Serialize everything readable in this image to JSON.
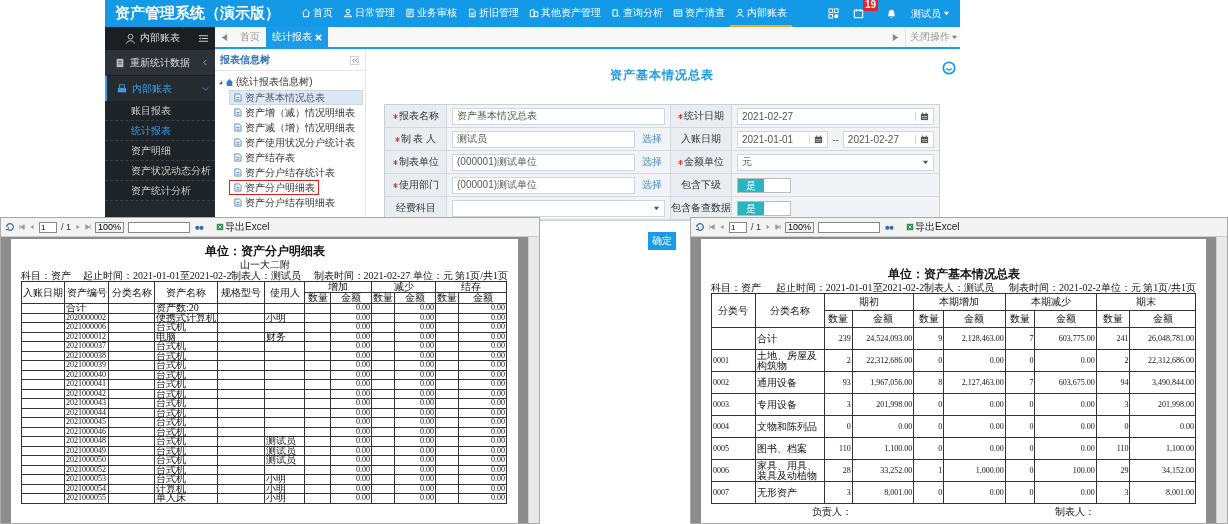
{
  "header": {
    "title": "资产管理系统（演示版）",
    "nav": [
      {
        "label": "首页",
        "selected": false
      },
      {
        "label": "日常管理",
        "selected": false
      },
      {
        "label": "业务审核",
        "selected": false
      },
      {
        "label": "折旧管理",
        "selected": false
      },
      {
        "label": "其他资产管理",
        "selected": false
      },
      {
        "label": "查询分析",
        "selected": false
      },
      {
        "label": "资产清查",
        "selected": false
      },
      {
        "label": "内部账表",
        "selected": true
      }
    ],
    "badge": "19",
    "user": "测试员"
  },
  "sidebar": {
    "title": "内部账表",
    "items": [
      {
        "label": "重新统计数据",
        "expanded": false
      },
      {
        "label": "内部账表",
        "expanded": true,
        "children": [
          {
            "label": "账目报表",
            "selected": false
          },
          {
            "label": "统计报表",
            "selected": true
          },
          {
            "label": "资产明细",
            "selected": false
          },
          {
            "label": "资产状况动态分析",
            "selected": false
          },
          {
            "label": "资产统计分析",
            "selected": false
          }
        ]
      }
    ]
  },
  "tabs": [
    {
      "label": "首页",
      "selected": false,
      "closable": false
    },
    {
      "label": "统计报表",
      "selected": true,
      "closable": true
    }
  ],
  "tab_menu": "关闭操作",
  "tree": {
    "title": "报表信息树",
    "root": {
      "label": "(统计报表信息树)",
      "expanded": true,
      "children": [
        {
          "label": "资产基本情况总表",
          "selected": true,
          "marked": false
        },
        {
          "label": "资产增（减）情况明细表",
          "selected": false,
          "marked": false
        },
        {
          "label": "资产减（增）情况明细表",
          "selected": false,
          "marked": false
        },
        {
          "label": "资产使用状况分户统计表",
          "selected": false,
          "marked": false
        },
        {
          "label": "资产结存表",
          "selected": false,
          "marked": false
        },
        {
          "label": "资产分户结存统计表",
          "selected": false,
          "marked": false
        },
        {
          "label": "资产分户明细表",
          "selected": false,
          "marked": true
        },
        {
          "label": "资产分户结存明细表",
          "selected": false,
          "marked": false
        }
      ]
    }
  },
  "form": {
    "title": "资产基本情况总表",
    "fields": [
      {
        "kind": "text",
        "label": "报表名称",
        "required": true,
        "value": "资产基本情况总表"
      },
      {
        "kind": "date",
        "label": "统计日期",
        "required": true,
        "value": "2021-02-27"
      },
      {
        "kind": "text",
        "label": "制 表 人",
        "required": true,
        "value": "测试员",
        "action": "选择"
      },
      {
        "kind": "date_range",
        "label": "入账日期",
        "required": false,
        "from": "2021-01-01",
        "separator": "--",
        "to": "2021-02-27"
      },
      {
        "kind": "text",
        "label": "制表单位",
        "required": true,
        "value": "(000001)测试单位",
        "action": "选择"
      },
      {
        "kind": "select",
        "label": "金额单位",
        "required": true,
        "value": "元"
      },
      {
        "kind": "text",
        "label": "使用部门",
        "required": true,
        "value": "(000001)测试单位",
        "action": "选择"
      },
      {
        "kind": "toggle",
        "label": "包含下级",
        "required": false,
        "on": true,
        "text": "是"
      },
      {
        "kind": "select",
        "label": "经费科目",
        "required": false
      },
      {
        "kind": "toggle",
        "label": "包含备查数据",
        "required": false,
        "on": true,
        "text": "是"
      }
    ],
    "submit": "确定"
  },
  "detail_report": {
    "toolbar": {
      "page": "1",
      "pages": "/ 1",
      "zoom": "100%",
      "export": "导出Excel"
    },
    "title": "单位：资产分户明细表",
    "subtitle": "山一大二附",
    "meta": [
      "科目：资产",
      "起止时间：2021-01-01至2021-02-2制表人：测试员",
      "制表时间：2021-02-27  单位：元  第1页/共1页"
    ],
    "columns": [
      "入账日期",
      "资产编号",
      "分类名称",
      "资产名称",
      "规格型号",
      "使用人"
    ],
    "groups": [
      {
        "label": "增加",
        "sub": [
          "数量",
          "金额"
        ]
      },
      {
        "label": "减少",
        "sub": [
          "数量",
          "金额"
        ]
      },
      {
        "label": "结存",
        "sub": [
          "数量",
          "金额"
        ]
      }
    ],
    "rows": [
      {
        "kind": "total",
        "code": "合计",
        "name": "资产数:20",
        "amounts": [
          "0.00",
          "0.00",
          "0.00"
        ]
      },
      {
        "kind": "item",
        "code": "2020000002",
        "name": "便携式计算机",
        "user": "小明",
        "amounts": [
          "0.00",
          "0.00",
          "0.00"
        ]
      },
      {
        "code": "2021000006",
        "name": "台式机",
        "amounts": [
          "0.00",
          "0.00",
          "0.00"
        ]
      },
      {
        "code": "2021000012",
        "name": "电脑",
        "user": "财务",
        "amounts": [
          "0.00",
          "0.00",
          "0.00"
        ]
      },
      {
        "code": "2021000037",
        "name": "台式机",
        "amounts": [
          "0.00",
          "0.00",
          "0.00"
        ]
      },
      {
        "code": "2021000038",
        "name": "台式机",
        "amounts": [
          "0.00",
          "0.00",
          "0.00"
        ]
      },
      {
        "code": "2021000039",
        "name": "台式机",
        "amounts": [
          "0.00",
          "0.00",
          "0.00"
        ]
      },
      {
        "code": "2021000040",
        "name": "台式机",
        "amounts": [
          "0.00",
          "0.00",
          "0.00"
        ]
      },
      {
        "code": "2021000041",
        "name": "台式机",
        "amounts": [
          "0.00",
          "0.00",
          "0.00"
        ]
      },
      {
        "code": "2021000042",
        "name": "台式机",
        "amounts": [
          "0.00",
          "0.00",
          "0.00"
        ]
      },
      {
        "code": "2021000043",
        "name": "台式机",
        "amounts": [
          "0.00",
          "0.00",
          "0.00"
        ]
      },
      {
        "code": "2021000044",
        "name": "台式机",
        "amounts": [
          "0.00",
          "0.00",
          "0.00"
        ]
      },
      {
        "code": "2021000045",
        "name": "台式机",
        "amounts": [
          "0.00",
          "0.00",
          "0.00"
        ]
      },
      {
        "code": "2021000046",
        "name": "台式机",
        "amounts": [
          "0.00",
          "0.00",
          "0.00"
        ]
      },
      {
        "code": "2021000048",
        "name": "台式机",
        "user": "测试员",
        "amounts": [
          "0.00",
          "0.00",
          "0.00"
        ]
      },
      {
        "code": "2021000049",
        "name": "台式机",
        "user": "测试员",
        "amounts": [
          "0.00",
          "0.00",
          "0.00"
        ]
      },
      {
        "code": "2021000050",
        "name": "台式机",
        "user": "测试员",
        "amounts": [
          "0.00",
          "0.00",
          "0.00"
        ]
      },
      {
        "code": "2021000052",
        "name": "台式机",
        "amounts": [
          "0.00",
          "0.00",
          "0.00"
        ]
      },
      {
        "code": "2021000053",
        "name": "台式机",
        "user": "小明",
        "amounts": [
          "0.00",
          "0.00",
          "0.00"
        ]
      },
      {
        "code": "2021000054",
        "name": "计算机",
        "user": "小明",
        "amounts": [
          "0.00",
          "0.00",
          "0.00"
        ]
      },
      {
        "code": "2021000055",
        "name": "单人床",
        "user": "小明",
        "amounts": [
          "0.00",
          "0.00",
          "0.00"
        ]
      }
    ]
  },
  "summary_report": {
    "toolbar": {
      "page": "1",
      "pages": "/ 1",
      "zoom": "100%",
      "export": "导出Excel"
    },
    "title": "单位：资产基本情况总表",
    "meta": [
      "科目：资产",
      "起止时间：2021-01-01至2021-02-2制表人：测试员",
      "制表时间：2021-02-2单位：元 第1页/共1页"
    ],
    "columns": [
      "分类号",
      "分类名称"
    ],
    "groups": [
      {
        "label": "期初",
        "sub": [
          "数量",
          "金额"
        ]
      },
      {
        "label": "本期增加",
        "sub": [
          "数量",
          "金额"
        ]
      },
      {
        "label": "本期减少",
        "sub": [
          "数量",
          "金额"
        ]
      },
      {
        "label": "期末",
        "sub": [
          "数量",
          "金额"
        ]
      }
    ],
    "rows": [
      {
        "name": "合计",
        "values": [
          "239",
          "24,524,093.00",
          "9",
          "2,128,463.00",
          "7",
          "603,775.00",
          "241",
          "26,048,781.00"
        ]
      },
      {
        "code": "0001",
        "name": "土地、房屋及构筑物",
        "values": [
          "2",
          "22,312,686.00",
          "0",
          "0.00",
          "0",
          "0.00",
          "2",
          "22,312,686.00"
        ]
      },
      {
        "code": "0002",
        "name": "通用设备",
        "values": [
          "93",
          "1,967,056.00",
          "8",
          "2,127,463.00",
          "7",
          "603,675.00",
          "94",
          "3,490,844.00"
        ]
      },
      {
        "code": "0003",
        "name": "专用设备",
        "values": [
          "3",
          "201,998.00",
          "0",
          "0.00",
          "0",
          "0.00",
          "3",
          "201,998.00"
        ]
      },
      {
        "code": "0004",
        "name": "文物和陈列品",
        "values": [
          "0",
          "0.00",
          "0",
          "0.00",
          "0",
          "0.00",
          "0",
          "0.00"
        ]
      },
      {
        "code": "0005",
        "name": "图书、档案",
        "values": [
          "110",
          "1,100.00",
          "0",
          "0.00",
          "0",
          "0.00",
          "110",
          "1,100.00"
        ]
      },
      {
        "code": "0006",
        "name": "家具、用具、装具及动植物",
        "values": [
          "28",
          "33,252.00",
          "1",
          "1,000.00",
          "0",
          "100.00",
          "29",
          "34,152.00"
        ]
      },
      {
        "code": "0007",
        "name": "无形资产",
        "values": [
          "3",
          "8,001.00",
          "0",
          "0.00",
          "0",
          "0.00",
          "3",
          "8,001.00"
        ]
      }
    ],
    "signatures": [
      "负责人：",
      "制表人："
    ]
  }
}
